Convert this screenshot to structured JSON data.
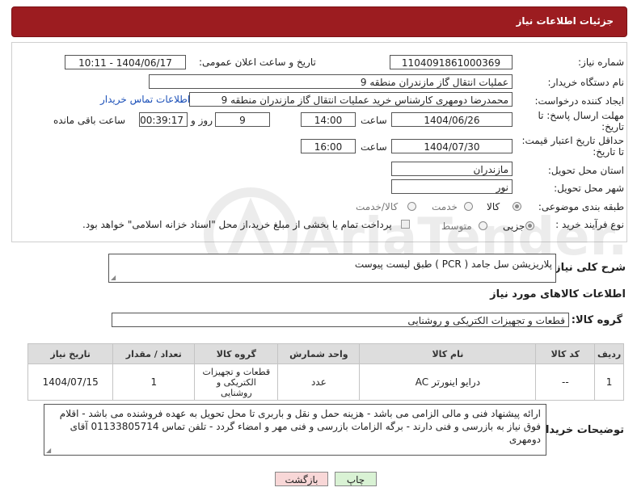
{
  "header": {
    "title": "جزئیات اطلاعات نیاز"
  },
  "form": {
    "need_number_label": "شماره نیاز:",
    "need_number": "1104091861000369",
    "announce_label": "تاریخ و ساعت اعلان عمومی:",
    "announce_value": "1404/06/17 - 10:11",
    "buyer_label": "نام دستگاه خریدار:",
    "buyer_value": "عملیات انتقال گاز مازندران منطقه 9",
    "creator_label": "ایجاد کننده درخواست:",
    "creator_value": "محمدرضا دومهری کارشناس خرید عملیات انتقال گاز مازندران منطقه 9",
    "contact_link": "اطلاعات تماس خریدار",
    "deadline_label_1": "مهلت ارسال پاسخ: تا",
    "deadline_label_2": "تاریخ:",
    "deadline_date": "1404/06/26",
    "time_label": "ساعت",
    "deadline_time": "14:00",
    "days_value": "9",
    "days_label": "روز و",
    "remaining_time": "00:39:17",
    "remaining_label": "ساعت باقی مانده",
    "price_label_1": "حداقل تاریخ اعتبار قیمت:",
    "price_label_2": "تا تاریخ:",
    "price_date": "1404/07/30",
    "price_time": "16:00",
    "province_label": "استان محل تحویل:",
    "province_value": "مازندران",
    "city_label": "شهر محل تحویل:",
    "city_value": "نور",
    "category_label": "طبقه بندی موضوعی:",
    "category_options": [
      "کالا",
      "خدمت",
      "کالا/خدمت"
    ],
    "category_selected": "کالا",
    "process_label": "نوع فرآیند خرید :",
    "process_options": [
      "جزیی",
      "متوسط"
    ],
    "process_selected": "جزیی",
    "payment_note": "پرداخت تمام یا بخشی از مبلغ خرید،از محل \"اسناد خزانه اسلامی\" خواهد بود."
  },
  "description": {
    "label": "شرح کلی نیاز:",
    "value": "پلاریزیشن سل جامد ( PCR ) طبق لیست پیوست"
  },
  "goods": {
    "section_title": "اطلاعات کالاهای مورد نیاز",
    "group_label": "گروه کالا:",
    "group_value": "قطعات و تجهیزات الکتریکی و روشنایی",
    "columns": [
      "ردیف",
      "کد کالا",
      "نام کالا",
      "واحد شمارش",
      "گروه کالا",
      "تعداد / مقدار",
      "تاریخ نیاز"
    ],
    "rows": [
      [
        "1",
        "--",
        "درایو اینورتر AC",
        "عدد",
        "قطعات و تجهیزات الکتریکی و روشنایی",
        "1",
        "1404/07/15"
      ]
    ]
  },
  "buyer_notes": {
    "label": "توضیحات خریدار:",
    "value": "ارائه پیشنهاد فنی و مالی الزامی می باشد - هزینه حمل و نقل و باربری تا محل تحویل به عهده فروشنده می باشد - اقلام فوق نیاز به بازرسی و فنی دارند - برگه الزامات بازرسی و فنی مهر و امضاء گردد - تلفن تماس 01133805714 آقای دومهری"
  },
  "buttons": {
    "print": "چاپ",
    "back": "بازگشت"
  },
  "watermark": "AriaTender.neT",
  "colors": {
    "header_bg": "#9c1c20",
    "table_header": "#dddddd",
    "link": "#1a4fb8",
    "back_button": "#f8d7d7",
    "print_button": "#d9f2d4"
  }
}
